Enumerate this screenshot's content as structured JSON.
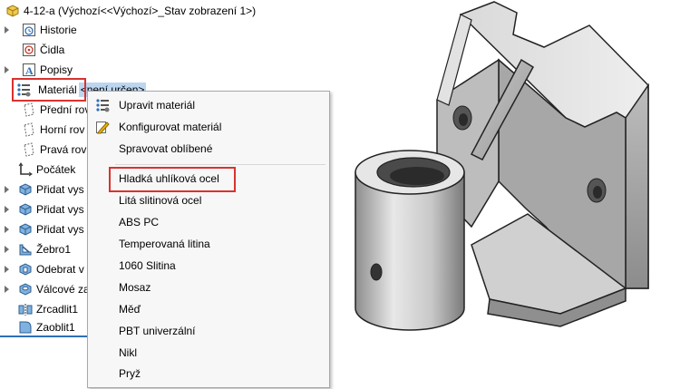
{
  "tree": {
    "root_label": "4-12-a  (Výchozí<<Výchozí>_Stav zobrazení 1>)",
    "items": [
      {
        "label": "Historie",
        "icon": "history-icon"
      },
      {
        "label": "Čidla",
        "icon": "sensors-icon"
      },
      {
        "label": "Popisy",
        "icon": "annotations-icon"
      },
      {
        "label": "Materiál",
        "suffix": "<není určen>",
        "icon": "material-icon"
      },
      {
        "label": "Přední rov",
        "icon": "plane-icon"
      },
      {
        "label": "Horní rov",
        "icon": "plane-icon"
      },
      {
        "label": "Pravá rovi",
        "icon": "plane-icon"
      },
      {
        "label": "Počátek",
        "icon": "origin-icon"
      },
      {
        "label": "Přidat vys",
        "icon": "extrude-icon"
      },
      {
        "label": "Přidat vys",
        "icon": "extrude-icon"
      },
      {
        "label": "Přidat vys",
        "icon": "extrude-icon"
      },
      {
        "label": "Žebro1",
        "icon": "rib-icon"
      },
      {
        "label": "Odebrat v",
        "icon": "cut-extrude-icon"
      },
      {
        "label": "Válcové za",
        "icon": "hole-icon"
      },
      {
        "label": "Zrcadlit1",
        "icon": "mirror-icon"
      },
      {
        "label": "Zaoblit1",
        "icon": "fillet-icon"
      }
    ]
  },
  "menu": {
    "items": [
      {
        "label": "Upravit materiál",
        "icon": "edit-material-icon"
      },
      {
        "label": "Konfigurovat materiál",
        "icon": "configure-material-icon"
      },
      {
        "label": "Spravovat oblíbené",
        "icon": ""
      },
      {
        "label": "Hladká uhlíková ocel",
        "icon": ""
      },
      {
        "label": "Litá slitinová ocel",
        "icon": ""
      },
      {
        "label": "ABS PC",
        "icon": ""
      },
      {
        "label": "Temperovaná litina",
        "icon": ""
      },
      {
        "label": "1060 Slitina",
        "icon": ""
      },
      {
        "label": "Mosaz",
        "icon": ""
      },
      {
        "label": "Měď",
        "icon": ""
      },
      {
        "label": "PBT univerzální",
        "icon": ""
      },
      {
        "label": "Nikl",
        "icon": ""
      },
      {
        "label": "Pryž",
        "icon": ""
      }
    ]
  },
  "colors": {
    "highlight_border": "#d9322f",
    "selection_bg": "#bcd6f0",
    "tree_bottom_border": "#2f6fb6"
  }
}
